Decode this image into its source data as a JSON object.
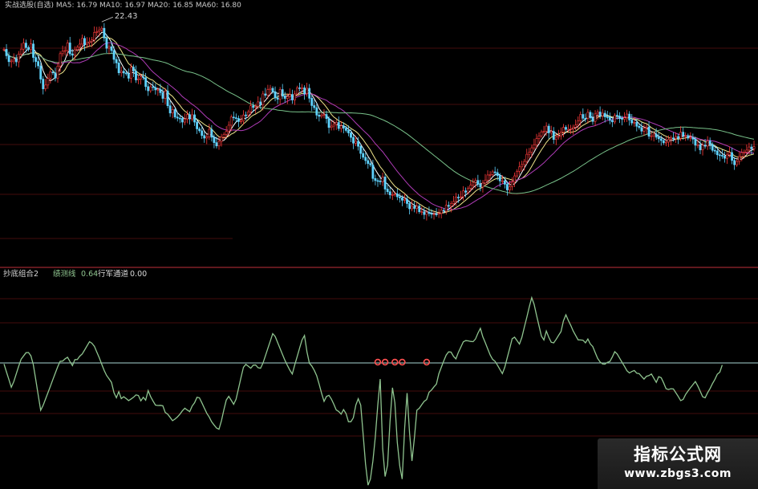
{
  "colors": {
    "background": "#000000",
    "up": "#ff3b3b",
    "down": "#5fd3ff",
    "ma_short": "#ffffff",
    "ma_mid": "#f0e68c",
    "ma_long_purple": "#b03cb8",
    "ma_long_green": "#79c28a",
    "grid": "#5a0f0f",
    "divider": "#c0303a",
    "osc_line": "#8fc48f",
    "osc_zero": "#a9d5d2",
    "signal": "#ff5050"
  },
  "top_header": {
    "text": "实战选股(自选)   MA5: 16.79  MA10: 16.97   MA20: 16.85   MA60: 16.80"
  },
  "watermark": {
    "line1": "指标公式网",
    "line2": "www.zbgs3.com"
  },
  "chart_data": [
    {
      "type": "candlestick",
      "title": "",
      "price_annotations": [
        {
          "label": "22.43"
        }
      ],
      "ylim": [
        11,
        23.5
      ],
      "x": [
        0,
        1,
        2,
        3,
        4,
        5,
        6,
        7,
        8,
        9,
        10,
        11,
        12,
        13,
        14,
        15,
        16,
        17,
        18,
        19,
        20,
        21,
        22,
        23,
        24,
        25,
        26,
        27,
        28,
        29,
        30,
        31,
        32,
        33,
        34,
        35,
        36,
        37,
        38,
        39,
        40,
        41,
        42,
        43,
        44,
        45,
        46,
        47,
        48,
        49,
        50,
        51,
        52,
        53,
        54,
        55,
        56,
        57,
        58,
        59,
        60,
        61,
        62,
        63,
        64,
        65,
        66,
        67,
        68,
        69,
        70,
        71,
        72,
        73,
        74,
        75,
        76,
        77,
        78,
        79,
        80,
        81,
        82,
        83,
        84,
        85,
        86,
        87,
        88,
        89,
        90,
        91,
        92,
        93,
        94,
        95,
        96,
        97,
        98,
        99,
        100,
        101,
        102,
        103,
        104,
        105,
        106,
        107,
        108,
        109,
        110,
        111,
        112,
        113,
        114,
        115,
        116,
        117,
        118,
        119,
        120,
        121,
        122,
        123,
        124,
        125,
        126,
        127,
        128,
        129,
        130,
        131,
        132,
        133,
        134,
        135,
        136,
        137,
        138,
        139,
        140,
        141,
        142,
        143,
        144,
        145,
        146,
        147,
        148,
        149,
        150,
        151,
        152,
        153,
        154,
        155,
        156,
        157,
        158,
        159,
        160,
        161,
        162,
        163,
        164,
        165,
        166,
        167,
        168,
        169,
        170,
        171,
        172,
        173,
        174,
        175,
        176,
        177,
        178,
        179,
        180,
        181,
        182,
        183,
        184,
        185,
        186,
        187,
        188,
        189,
        190,
        191,
        192,
        193,
        194,
        195,
        196,
        197,
        198,
        199,
        200,
        201,
        202,
        203,
        204,
        205,
        206,
        207,
        208,
        209,
        210,
        211,
        212,
        213,
        214,
        215,
        216,
        217,
        218,
        219,
        220,
        221,
        222,
        223,
        224,
        225,
        226,
        227,
        228,
        229,
        230,
        231,
        232,
        233,
        234,
        235,
        236,
        237,
        238,
        239,
        240,
        241,
        242,
        243,
        244,
        245,
        246,
        247,
        248,
        249,
        250,
        251,
        252,
        253,
        254,
        255,
        256,
        257,
        258,
        259,
        260,
        261,
        262,
        263,
        264,
        265,
        266,
        267,
        268,
        269,
        270,
        271,
        272,
        273,
        274,
        275,
        276,
        277,
        278,
        279,
        280,
        281,
        282,
        283,
        284,
        285,
        286,
        287,
        288,
        289,
        290,
        291,
        292,
        293,
        294,
        295,
        296,
        297,
        298,
        299,
        300,
        301,
        302,
        303,
        304,
        305,
        306,
        307,
        308,
        309,
        310,
        311,
        312,
        313,
        314
      ],
      "close": [
        21.22,
        20.85,
        20.51,
        20.55,
        20.67,
        20.5,
        20.95,
        21.23,
        21.58,
        21.32,
        21.21,
        21.53,
        20.75,
        20.52,
        20.27,
        19.51,
        18.95,
        19.17,
        19.55,
        19.92,
        19.87,
        19.57,
        20.26,
        20.97,
        21.11,
        21.15,
        21.59,
        20.96,
        20.88,
        21.2,
        21.34,
        21.52,
        21.85,
        21.48,
        21.6,
        21.66,
        21.76,
        22.19,
        22.24,
        22.33,
        22.43,
        21.87,
        21.28,
        21.37,
        21.15,
        20.64,
        20.44,
        19.87,
        19.96,
        19.86,
        19.82,
        19.56,
        20.2,
        19.97,
        19.46,
        19.52,
        19.64,
        19.59,
        19.08,
        18.84,
        19.07,
        19.03,
        18.89,
        18.92,
        18.73,
        18.4,
        18.83,
        17.98,
        17.56,
        17.76,
        17.33,
        17.27,
        17.25,
        17.04,
        17.22,
        17.47,
        17.22,
        17.46,
        17.04,
        16.65,
        16.54,
        16.27,
        16.12,
        16.19,
        16.62,
        16.17,
        15.86,
        15.67,
        15.93,
        16.17,
        16.33,
        16.51,
        16.86,
        17.33,
        17.29,
        17.25,
        17.07,
        17.1,
        17.45,
        17.43,
        17.63,
        17.98,
        17.88,
        17.94,
        18.2,
        18.03,
        18.66,
        18.58,
        18.91,
        18.98,
        18.79,
        18.43,
        18.35,
        18.91,
        18.53,
        18.4,
        18.51,
        18.63,
        18.31,
        18.66,
        19.01,
        18.99,
        19.01,
        18.67,
        18.98,
        18.41,
        17.99,
        17.87,
        17.44,
        17.37,
        17.45,
        17.48,
        17.24,
        16.73,
        16.81,
        16.91,
        17.02,
        16.67,
        16.83,
        16.69,
        16.56,
        16.42,
        16.16,
        15.83,
        15.94,
        15.65,
        15.24,
        15.02,
        14.83,
        14.66,
        14.58,
        13.8,
        13.68,
        13.66,
        13.61,
        13.89,
        13.19,
        13.04,
        12.86,
        12.87,
        12.92,
        12.75,
        12.69,
        12.55,
        12.61,
        12.36,
        12.06,
        12.21,
        12.08,
        12.22,
        11.89,
        11.89,
        11.73,
        11.87,
        11.79,
        11.76,
        11.76,
        11.75,
        11.8,
        11.98,
        11.92,
        12.26,
        12.2,
        12.36,
        12.48,
        12.73,
        12.72,
        12.75,
        13.09,
        13.01,
        13.24,
        13.42,
        13.58,
        13.69,
        13.48,
        13.31,
        13.54,
        13.71,
        14.0,
        14.03,
        14.18,
        14.14,
        13.97,
        13.66,
        13.67,
        13.47,
        13.14,
        13.33,
        13.6,
        13.95,
        14.21,
        14.47,
        14.6,
        14.78,
        15.19,
        15.31,
        15.56,
        15.74,
        16.09,
        16.25,
        16.48,
        16.52,
        16.81,
        16.42,
        16.51,
        16.04,
        16.18,
        16.25,
        16.46,
        16.74,
        16.62,
        16.62,
        16.66,
        16.75,
        16.87,
        17.12,
        17.48,
        17.26,
        17.25,
        17.6,
        17.29,
        17.08,
        17.51,
        17.62,
        17.39,
        17.55,
        17.34,
        17.32,
        17.14,
        17.05,
        17.43,
        17.39,
        17.26,
        17.2,
        17.29,
        17.5,
        17.16,
        16.99,
        17.03,
        16.8,
        16.73,
        16.52,
        16.7,
        16.76,
        16.23,
        16.25,
        16.35,
        16.17,
        16.08,
        15.98,
        15.85,
        15.89,
        16.05,
        16.13,
        16.09,
        16.21,
        16.1,
        16.46,
        16.25,
        16.26,
        16.12,
        16.16,
        16.06,
        15.71,
        15.74,
        15.44,
        15.72,
        15.66,
        15.96,
        15.76,
        15.42,
        15.38,
        15.16,
        15.13,
        15.1,
        14.96,
        15.16,
        15.29,
        14.84,
        14.59,
        14.78,
        15.06,
        15.29,
        15.32,
        15.43,
        15.61,
        15.5,
        15.63
      ]
    },
    {
      "type": "line",
      "title": "抄底组合2",
      "legend": [
        {
          "name": "绩测线",
          "value": "0.64"
        },
        {
          "name": "行军通道",
          "value": "0.00"
        }
      ],
      "ylim": [
        -60,
        40
      ],
      "zero_line": 0,
      "x": [
        0,
        1,
        2,
        3,
        4,
        5,
        6,
        7,
        8,
        9,
        10,
        11,
        12,
        13,
        14,
        15,
        16,
        17,
        18,
        19,
        20,
        21,
        22,
        23,
        24,
        25,
        26,
        27,
        28,
        29,
        30,
        31,
        32,
        33,
        34,
        35,
        36,
        37,
        38,
        39,
        40,
        41,
        42,
        43,
        44,
        45,
        46,
        47,
        48,
        49,
        50,
        51,
        52,
        53,
        54,
        55,
        56,
        57,
        58,
        59,
        60,
        61,
        62,
        63,
        64,
        65,
        66,
        67,
        68,
        69,
        70,
        71,
        72,
        73,
        74,
        75,
        76,
        77,
        78,
        79,
        80,
        81,
        82,
        83,
        84,
        85,
        86,
        87,
        88,
        89,
        90,
        91,
        92,
        93,
        94,
        95,
        96,
        97,
        98,
        99,
        100,
        101,
        102,
        103,
        104,
        105,
        106,
        107,
        108,
        109,
        110,
        111,
        112,
        113,
        114,
        115,
        116,
        117,
        118,
        119,
        120,
        121,
        122,
        123,
        124,
        125,
        126,
        127,
        128,
        129,
        130,
        131,
        132,
        133,
        134,
        135,
        136,
        137,
        138,
        139,
        140,
        141,
        142,
        143,
        144,
        145,
        146,
        147,
        148,
        149,
        150,
        151,
        152,
        153,
        154,
        155,
        156,
        157,
        158,
        159,
        160,
        161,
        162,
        163,
        164,
        165,
        166,
        167,
        168,
        169,
        170,
        171,
        172,
        173,
        174,
        175,
        176,
        177,
        178,
        179,
        180,
        181,
        182,
        183,
        184,
        185,
        186,
        187,
        188,
        189,
        190,
        191,
        192,
        193,
        194,
        195,
        196,
        197,
        198,
        199,
        200,
        201,
        202,
        203,
        204,
        205,
        206,
        207,
        208,
        209,
        210,
        211,
        212,
        213,
        214,
        215,
        216,
        217,
        218,
        219,
        220,
        221,
        222,
        223,
        224,
        225,
        226,
        227,
        228,
        229,
        230,
        231,
        232,
        233,
        234,
        235,
        236,
        237,
        238,
        239,
        240,
        241,
        242,
        243,
        244,
        245,
        246,
        247,
        248,
        249,
        250,
        251,
        252,
        253,
        254,
        255,
        256,
        257,
        258,
        259,
        260,
        261,
        262,
        263,
        264,
        265,
        266,
        267,
        268,
        269,
        270,
        271,
        272,
        273,
        274,
        275,
        276,
        277,
        278,
        279,
        280,
        281,
        282,
        283,
        284,
        285,
        286,
        287,
        288,
        289,
        290,
        291,
        292,
        293,
        294,
        295,
        296,
        297,
        298,
        299,
        300,
        301,
        302,
        303,
        304,
        305,
        306,
        307,
        308,
        309,
        310,
        311,
        312,
        313,
        314
      ],
      "y": [
        -0.5,
        -4.3,
        -8.1,
        -11.9,
        -9.1,
        -5.4,
        -1.6,
        1.8,
        3.4,
        5.0,
        5.1,
        3.5,
        -0.8,
        -8.2,
        -15.6,
        -23.1,
        -20.8,
        -17.6,
        -14.5,
        -11.3,
        -8.1,
        -4.9,
        -1.8,
        0.8,
        0.9,
        2.0,
        2.8,
        0.7,
        -1.3,
        1.6,
        1.7,
        3.3,
        4.4,
        6.3,
        8.4,
        10.4,
        9.6,
        8.1,
        5.3,
        2.5,
        -0.6,
        -3.7,
        -6.1,
        -7.8,
        -9.5,
        -14.5,
        -17.0,
        -14.0,
        -17.4,
        -16.5,
        -17.4,
        -18.4,
        -17.6,
        -16.8,
        -15.6,
        -15.9,
        -18.5,
        -16.8,
        -18.2,
        -13.5,
        -16.4,
        -18.6,
        -20.6,
        -20.8,
        -20.7,
        -20.9,
        -24.2,
        -25.0,
        -26.6,
        -28.2,
        -27.4,
        -26.4,
        -25.0,
        -23.4,
        -22.1,
        -23.0,
        -23.8,
        -21.1,
        -19.4,
        -16.8,
        -17.0,
        -19.5,
        -22.0,
        -24.6,
        -26.4,
        -28.8,
        -30.3,
        -31.8,
        -32.4,
        -28.2,
        -22.9,
        -18.1,
        -16.3,
        -18.2,
        -20.2,
        -17.7,
        -12.4,
        -7.2,
        -2.1,
        -0.7,
        -1.6,
        -2.6,
        -1.1,
        -1.0,
        -2.3,
        -2.6,
        -0.1,
        3.5,
        7.1,
        10.7,
        14.3,
        12.9,
        10.0,
        7.0,
        4.1,
        1.3,
        -1.2,
        -3.5,
        -5.4,
        -1.0,
        3.1,
        7.2,
        11.3,
        13.4,
        5.4,
        -0.1,
        -1.5,
        -3.6,
        -6.2,
        -10.4,
        -14.8,
        -18.8,
        -16.4,
        -15.8,
        -17.6,
        -20.2,
        -23.0,
        -23.7,
        -25.0,
        -22.8,
        -24.7,
        -28.7,
        -28.7,
        -26.8,
        -20.6,
        -17.5,
        -20.6,
        -34.7,
        -49.3,
        -59.7,
        -56.7,
        -47.9,
        -36.1,
        -20.5,
        -7.9,
        -41.8,
        -55.5,
        -49.9,
        -28.8,
        -12.1,
        -19.5,
        -38.8,
        -50.4,
        -56.7,
        -31.8,
        -14.7,
        -34.2,
        -47.9,
        -36.4,
        -23.1,
        -22.1,
        -20.4,
        -18.8,
        -17.9,
        -14.3,
        -13.2,
        -11.7,
        -10.3,
        -5.3,
        -2.1,
        1.0,
        3.9,
        5.4,
        5.3,
        3.2,
        2.0,
        5.2,
        7.7,
        10.3,
        10.9,
        10.8,
        10.5,
        10.4,
        11.7,
        14.5,
        16.9,
        12.8,
        9.9,
        6.9,
        3.9,
        1.8,
        0.8,
        -1.1,
        -3.2,
        -5.2,
        -2.1,
        2.6,
        7.0,
        11.8,
        12.6,
        10.9,
        9.2,
        12.6,
        17.5,
        22.3,
        27.3,
        31.9,
        28.6,
        23.3,
        18.1,
        13.1,
        11.2,
        15.6,
        12.5,
        10.1,
        9.8,
        11.5,
        13.5,
        15.3,
        20.5,
        23.5,
        20.8,
        18.3,
        15.6,
        13.4,
        11.3,
        11.2,
        11.1,
        9.8,
        11.7,
        9.3,
        8.0,
        5.1,
        2.2,
        0.5,
        -0.5,
        -0.6,
        0.3,
        0.7,
        2.9,
        5.5,
        4.4,
        2.3,
        0.3,
        -1.7,
        -3.8,
        -4.9,
        -4.2,
        -3.7,
        -5.0,
        -5.2,
        -6.6,
        -7.9,
        -6.5,
        -6.2,
        -5.4,
        -7.4,
        -9.5,
        -6.7,
        -7.2,
        -9.7,
        -12.6,
        -13.0,
        -12.6,
        -12.7,
        -14.5,
        -16.4,
        -18.4,
        -17.8,
        -15.4,
        -13.7,
        -12.1,
        -10.6,
        -9.1,
        -11.3,
        -13.9,
        -16.5,
        -17.0,
        -14.6,
        -12.5,
        -10.1,
        -8.0,
        -5.5,
        -4.5,
        -1.0
      ],
      "signals": [
        {
          "x": 153,
          "y": 0
        },
        {
          "x": 156,
          "y": 0
        },
        {
          "x": 160,
          "y": 0
        },
        {
          "x": 163,
          "y": 0
        },
        {
          "x": 173,
          "y": 0
        }
      ]
    }
  ]
}
